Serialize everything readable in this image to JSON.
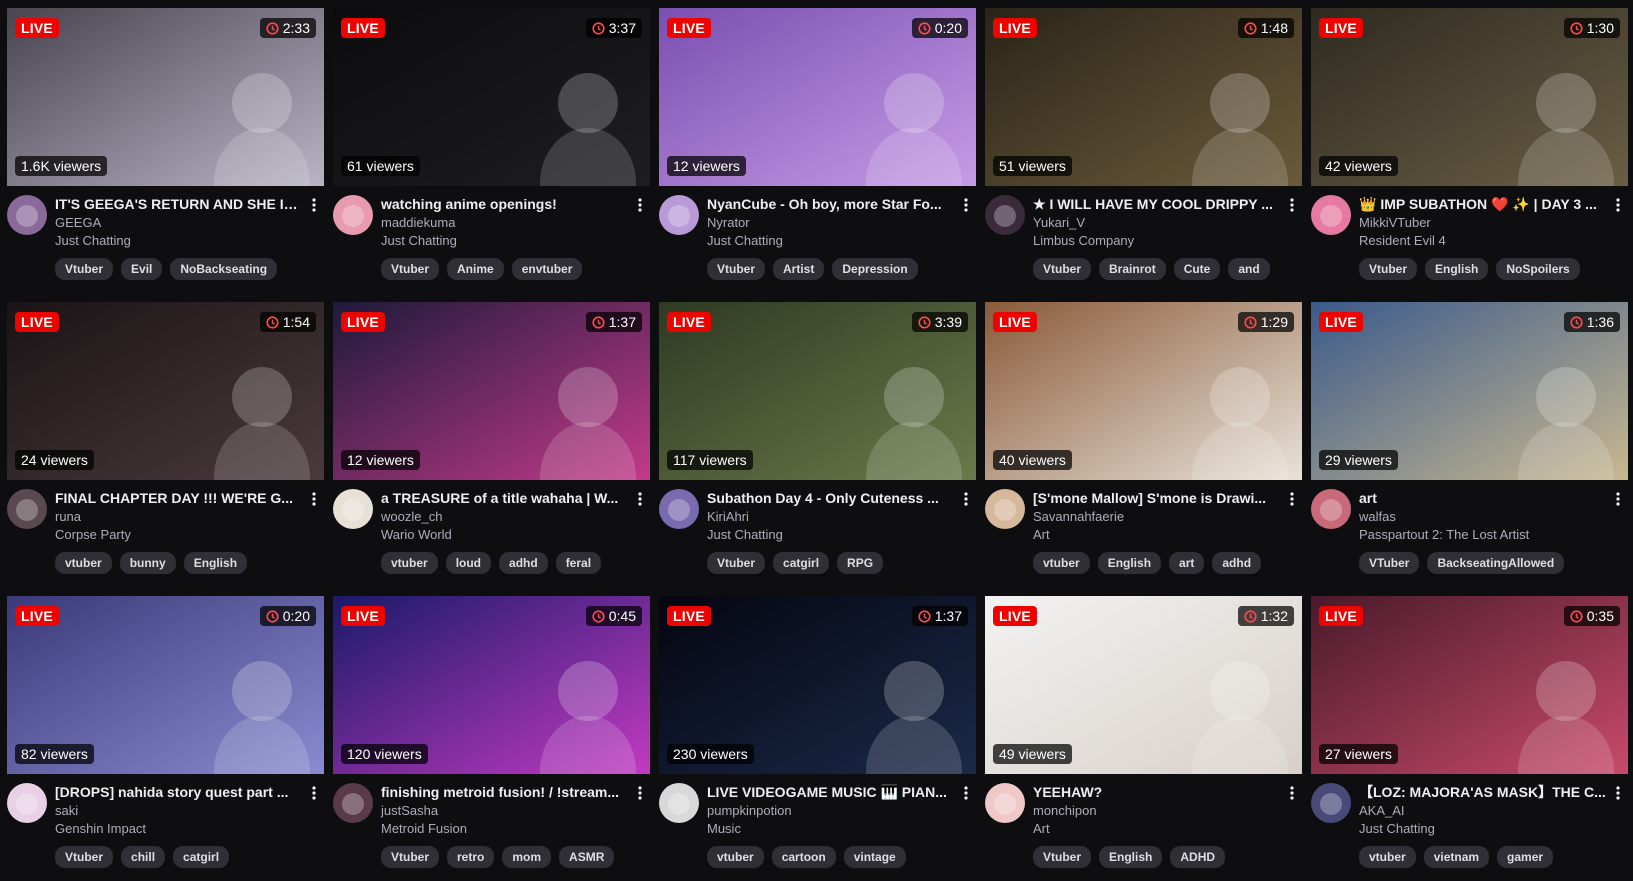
{
  "live_label": "LIVE",
  "icons": {
    "timer": "timer-icon",
    "kebab": "more-options-icon"
  },
  "colors": {
    "live_badge": "#eb0400",
    "tag_bg": "#2f2f35",
    "page_bg": "#0e0e10"
  },
  "streams": [
    {
      "title": "IT'S GEEGA'S RETURN AND SHE IS...",
      "channel": "GEEGA",
      "category": "Just Chatting",
      "viewers": "1.6K viewers",
      "uptime": "2:33",
      "tags": [
        "Vtuber",
        "Evil",
        "NoBackseating"
      ],
      "thumb": [
        "#4a4350",
        "#b8b4c4"
      ],
      "avatar": "#8a6a9a"
    },
    {
      "title": "watching anime openings!",
      "channel": "maddiekuma",
      "category": "Just Chatting",
      "viewers": "61 viewers",
      "uptime": "3:37",
      "tags": [
        "Vtuber",
        "Anime",
        "envtuber"
      ],
      "thumb": [
        "#0c0c0e",
        "#1e1e22"
      ],
      "avatar": "#e89aae"
    },
    {
      "title": "NyanCube - Oh boy, more Star Fo...",
      "channel": "Nyrator",
      "category": "Just Chatting",
      "viewers": "12 viewers",
      "uptime": "0:20",
      "tags": [
        "Vtuber",
        "Artist",
        "Depression"
      ],
      "thumb": [
        "#7a4fb0",
        "#c79be6"
      ],
      "avatar": "#b89ad6"
    },
    {
      "title": "★ I WILL HAVE MY COOL DRIPPY ...",
      "channel": "Yukari_V",
      "category": "Limbus Company",
      "viewers": "51 viewers",
      "uptime": "1:48",
      "tags": [
        "Vtuber",
        "Brainrot",
        "Cute",
        "and"
      ],
      "thumb": [
        "#2a2418",
        "#6b5a3a"
      ],
      "avatar": "#3a2a3a"
    },
    {
      "title": "👑 IMP SUBATHON ❤️ ✨ | DAY 3 ...",
      "channel": "MikkiVTuber",
      "category": "Resident Evil 4",
      "viewers": "42 viewers",
      "uptime": "1:30",
      "tags": [
        "Vtuber",
        "English",
        "NoSpoilers"
      ],
      "thumb": [
        "#2e2a20",
        "#6a5e44"
      ],
      "avatar": "#e67aa0"
    },
    {
      "title": "FINAL CHAPTER DAY !!! WE'RE G...",
      "channel": "runa",
      "category": "Corpse Party",
      "viewers": "24 viewers",
      "uptime": "1:54",
      "tags": [
        "vtuber",
        "bunny",
        "English"
      ],
      "thumb": [
        "#1a1416",
        "#4a3a3c"
      ],
      "avatar": "#5a4a50"
    },
    {
      "title": "a TREASURE of a title wahaha | W...",
      "channel": "woozle_ch",
      "category": "Wario World",
      "viewers": "12 viewers",
      "uptime": "1:37",
      "tags": [
        "vtuber",
        "loud",
        "adhd",
        "feral"
      ],
      "thumb": [
        "#1e1a3a",
        "#c23a8a"
      ],
      "avatar": "#e6e0d6"
    },
    {
      "title": "Subathon Day 4 - Only Cuteness ...",
      "channel": "KiriAhri",
      "category": "Just Chatting",
      "viewers": "117 viewers",
      "uptime": "3:39",
      "tags": [
        "Vtuber",
        "catgirl",
        "RPG"
      ],
      "thumb": [
        "#2e3a22",
        "#6a7a4a"
      ],
      "avatar": "#7a6ab0"
    },
    {
      "title": "[S'mone Mallow] S'mone is Drawi...",
      "channel": "Savannahfaerie",
      "category": "Art",
      "viewers": "40 viewers",
      "uptime": "1:29",
      "tags": [
        "vtuber",
        "English",
        "art",
        "adhd"
      ],
      "thumb": [
        "#8a5a3a",
        "#e8e2d8"
      ],
      "avatar": "#d6b89a"
    },
    {
      "title": "art",
      "channel": "walfas",
      "category": "Passpartout 2: The Lost Artist",
      "viewers": "29 viewers",
      "uptime": "1:36",
      "tags": [
        "VTuber",
        "BackseatingAllowed"
      ],
      "thumb": [
        "#3a5a8a",
        "#c8b890"
      ],
      "avatar": "#c86a7a"
    },
    {
      "title": "[DROPS] nahida story quest part ...",
      "channel": "saki",
      "category": "Genshin Impact",
      "viewers": "82 viewers",
      "uptime": "0:20",
      "tags": [
        "Vtuber",
        "chill",
        "catgirl"
      ],
      "thumb": [
        "#3a3a7a",
        "#8a8ad0"
      ],
      "avatar": "#e8d0e6"
    },
    {
      "title": "finishing metroid fusion! / !stream...",
      "channel": "justSasha",
      "category": "Metroid Fusion",
      "viewers": "120 viewers",
      "uptime": "0:45",
      "tags": [
        "Vtuber",
        "retro",
        "mom",
        "ASMR"
      ],
      "thumb": [
        "#1a1a6a",
        "#c23ac2"
      ],
      "avatar": "#5a3a4a"
    },
    {
      "title": "LIVE VIDEOGAME MUSIC 🎹 PIAN...",
      "channel": "pumpkinpotion",
      "category": "Music",
      "viewers": "230 viewers",
      "uptime": "1:37",
      "tags": [
        "vtuber",
        "cartoon",
        "vintage"
      ],
      "thumb": [
        "#050510",
        "#1a2a4a"
      ],
      "avatar": "#d8d8d8"
    },
    {
      "title": "YEEHAW?",
      "channel": "monchipon",
      "category": "Art",
      "viewers": "49 viewers",
      "uptime": "1:32",
      "tags": [
        "Vtuber",
        "English",
        "ADHD"
      ],
      "thumb": [
        "#f2f2f2",
        "#d8d0c8"
      ],
      "avatar": "#f0c8c8"
    },
    {
      "title": "【LOZ: MAJORA'AS MASK】THE C...",
      "channel": "AKA_AI",
      "category": "Just Chatting",
      "viewers": "27 viewers",
      "uptime": "0:35",
      "tags": [
        "vtuber",
        "vietnam",
        "gamer"
      ],
      "thumb": [
        "#4a1a2a",
        "#c84a6a"
      ],
      "avatar": "#4a4a7a"
    }
  ]
}
